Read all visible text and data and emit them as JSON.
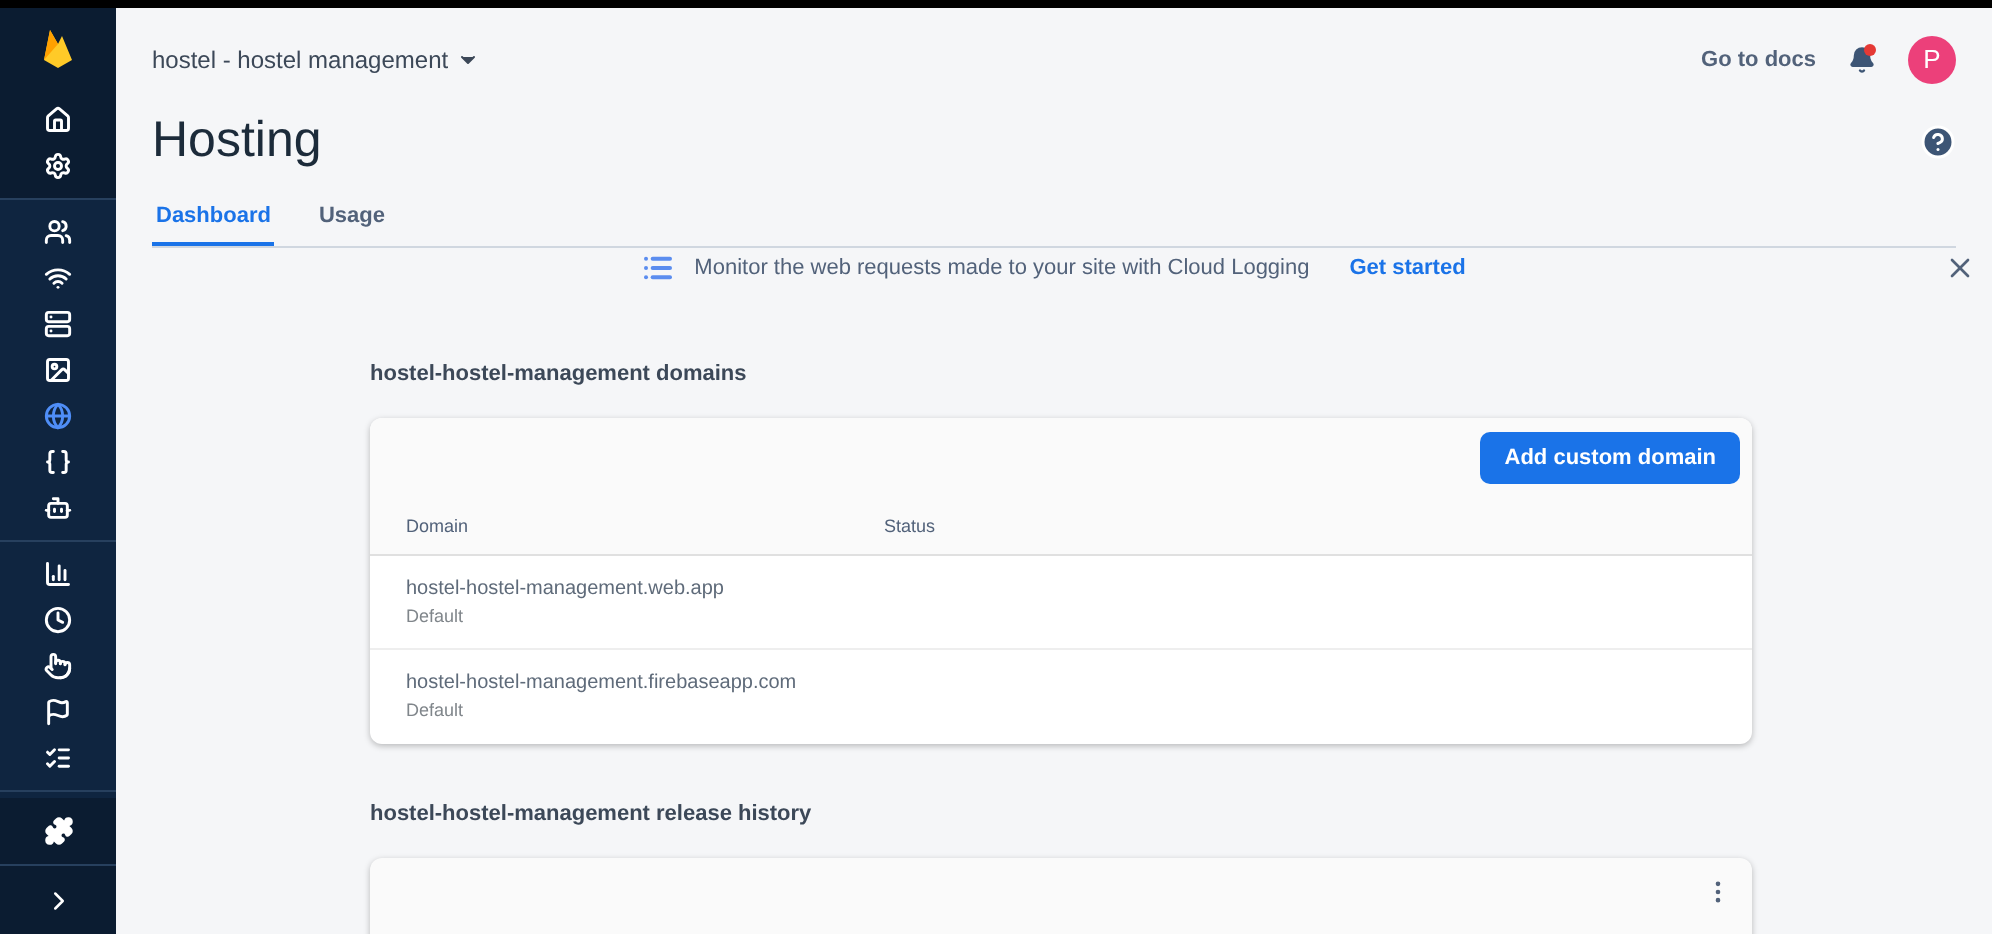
{
  "sidebar": {
    "groups": [
      [
        {
          "selected": false
        },
        {
          "selected": false
        }
      ],
      [
        {
          "selected": false
        },
        {
          "selected": false
        },
        {
          "selected": false
        },
        {
          "selected": false
        },
        {
          "selected": true
        },
        {
          "selected": false
        },
        {
          "selected": false
        }
      ],
      [
        {
          "selected": false
        },
        {
          "selected": false
        },
        {
          "selected": false
        },
        {
          "selected": false
        },
        {
          "selected": false
        }
      ]
    ]
  },
  "header": {
    "project": "hostel - hostel management",
    "docs_link": "Go to docs",
    "notification": true,
    "avatar": "P"
  },
  "page": {
    "title": "Hosting"
  },
  "tabs": [
    {
      "label": "Dashboard",
      "selected": true
    },
    {
      "label": "Usage",
      "selected": false
    }
  ],
  "banner": {
    "text": "Monitor the web requests made to your site with Cloud Logging",
    "action": "Get started"
  },
  "domains": {
    "title": "hostel-hostel-management domains",
    "button": "Add custom domain",
    "columns": [
      "Domain",
      "Status"
    ],
    "rows": [
      {
        "domain": "hostel-hostel-management.web.app",
        "note": "Default"
      },
      {
        "domain": "hostel-hostel-management.firebaseapp.com",
        "note": "Default"
      }
    ]
  },
  "release_history": {
    "title": "hostel-hostel-management release history"
  }
}
